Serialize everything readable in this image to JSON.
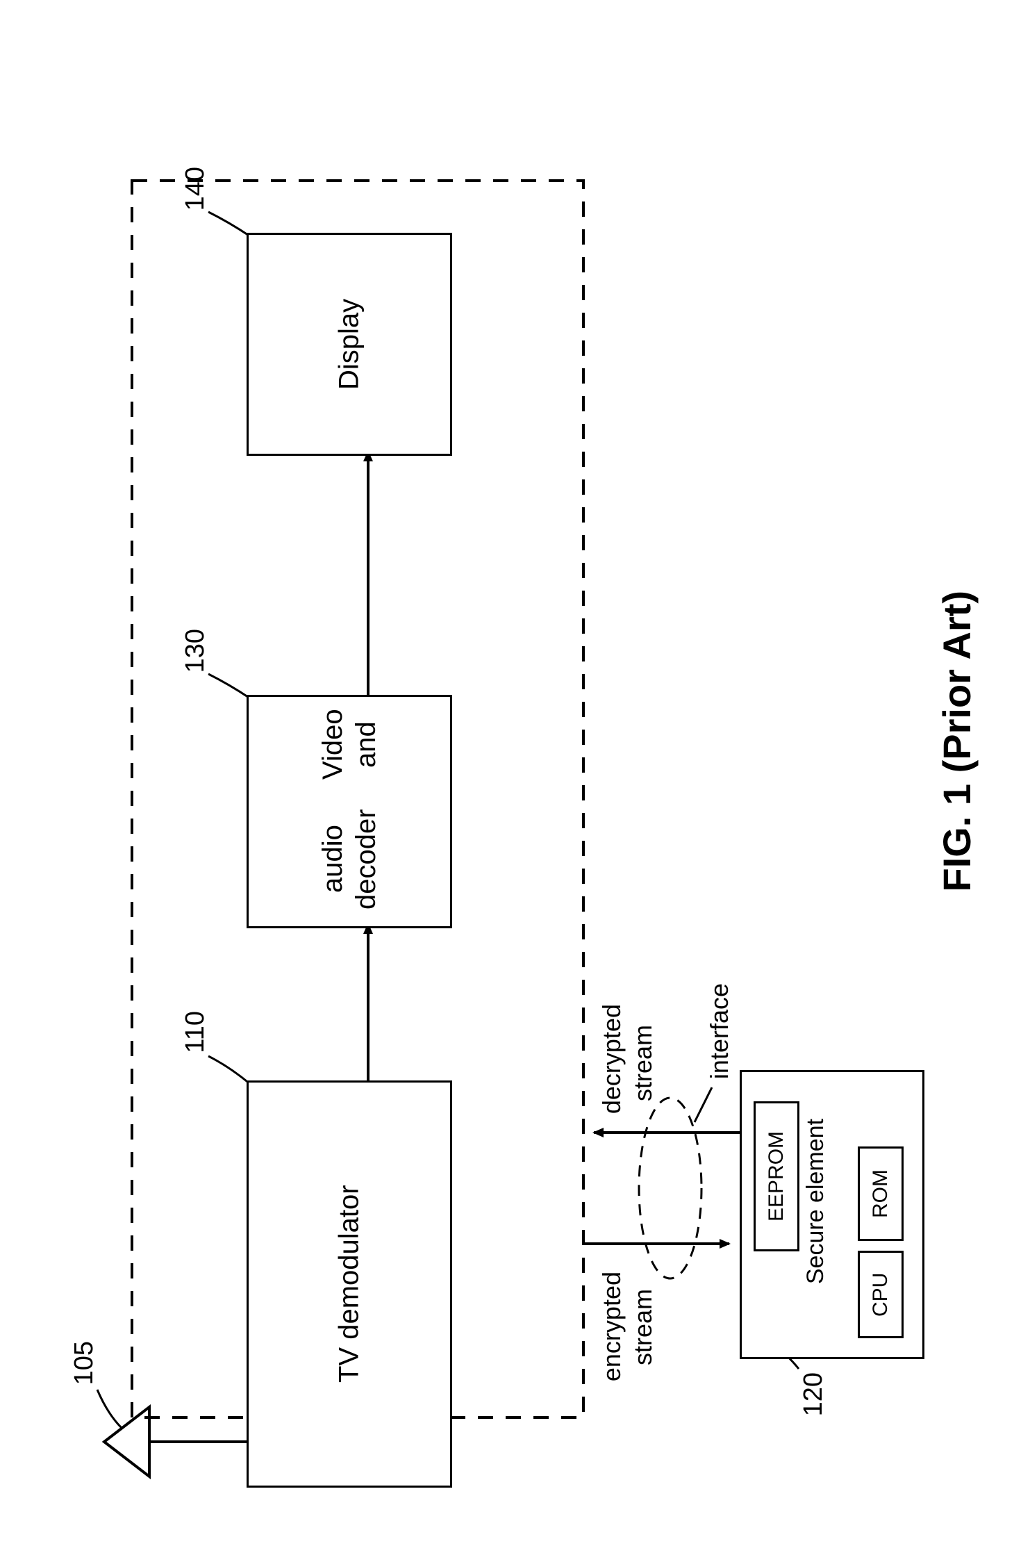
{
  "figure_caption": "FIG. 1 (Prior Art)",
  "refs": {
    "antenna": "105",
    "demod": "110",
    "secure": "120",
    "decoder": "130",
    "display": "140"
  },
  "blocks": {
    "demod": "TV demodulator",
    "decoder_line1": "Video and",
    "decoder_line2": "audio decoder",
    "display": "Display",
    "secure": "Secure element",
    "cpu": "CPU",
    "rom": "ROM",
    "eeprom": "EEPROM"
  },
  "labels": {
    "encrypted_line1": "encrypted",
    "encrypted_line2": "stream",
    "decrypted_line1": "decrypted",
    "decrypted_line2": "stream",
    "interface": "interface"
  }
}
